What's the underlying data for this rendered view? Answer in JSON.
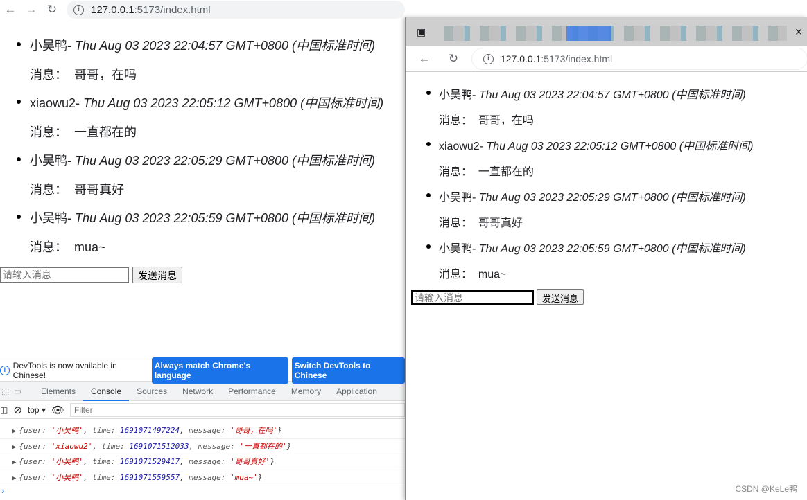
{
  "browser": {
    "url_host": "127.0.0.1",
    "url_rest": ":5173/index.html"
  },
  "messages": [
    {
      "user": "小吴鸭",
      "time": "Thu Aug 03 2023 22:04:57 GMT+0800 (中国标准时间)",
      "message": "哥哥，在吗"
    },
    {
      "user": "xiaowu2",
      "time": "Thu Aug 03 2023 22:05:12 GMT+0800 (中国标准时间)",
      "message": "一直都在的"
    },
    {
      "user": "小吴鸭",
      "time": "Thu Aug 03 2023 22:05:29 GMT+0800 (中国标准时间)",
      "message": "哥哥真好"
    },
    {
      "user": "小吴鸭",
      "time": "Thu Aug 03 2023 22:05:59 GMT+0800 (中国标准时间)",
      "message": "mua~"
    }
  ],
  "msg_label": "消息：",
  "input_placeholder": "请输入消息",
  "send_label": "发送消息",
  "devtools": {
    "info": "DevTools is now available in Chinese!",
    "btn1": "Always match Chrome's language",
    "btn2": "Switch DevTools to Chinese",
    "tabs": [
      "Elements",
      "Console",
      "Sources",
      "Network",
      "Performance",
      "Memory",
      "Application"
    ],
    "context": "top",
    "filter_placeholder": "Filter",
    "logs": [
      {
        "user": "'小吴鸭'",
        "time": "1691071497224",
        "message": "'哥哥，在吗'"
      },
      {
        "user": "'xiaowu2'",
        "time": "1691071512033",
        "message": "'一直都在的'"
      },
      {
        "user": "'小吴鸭'",
        "time": "1691071529417",
        "message": "'哥哥真好'"
      },
      {
        "user": "'小吴鸭'",
        "time": "1691071559557",
        "message": "'mua~'"
      }
    ]
  },
  "watermark": "CSDN @KeLe鸭"
}
